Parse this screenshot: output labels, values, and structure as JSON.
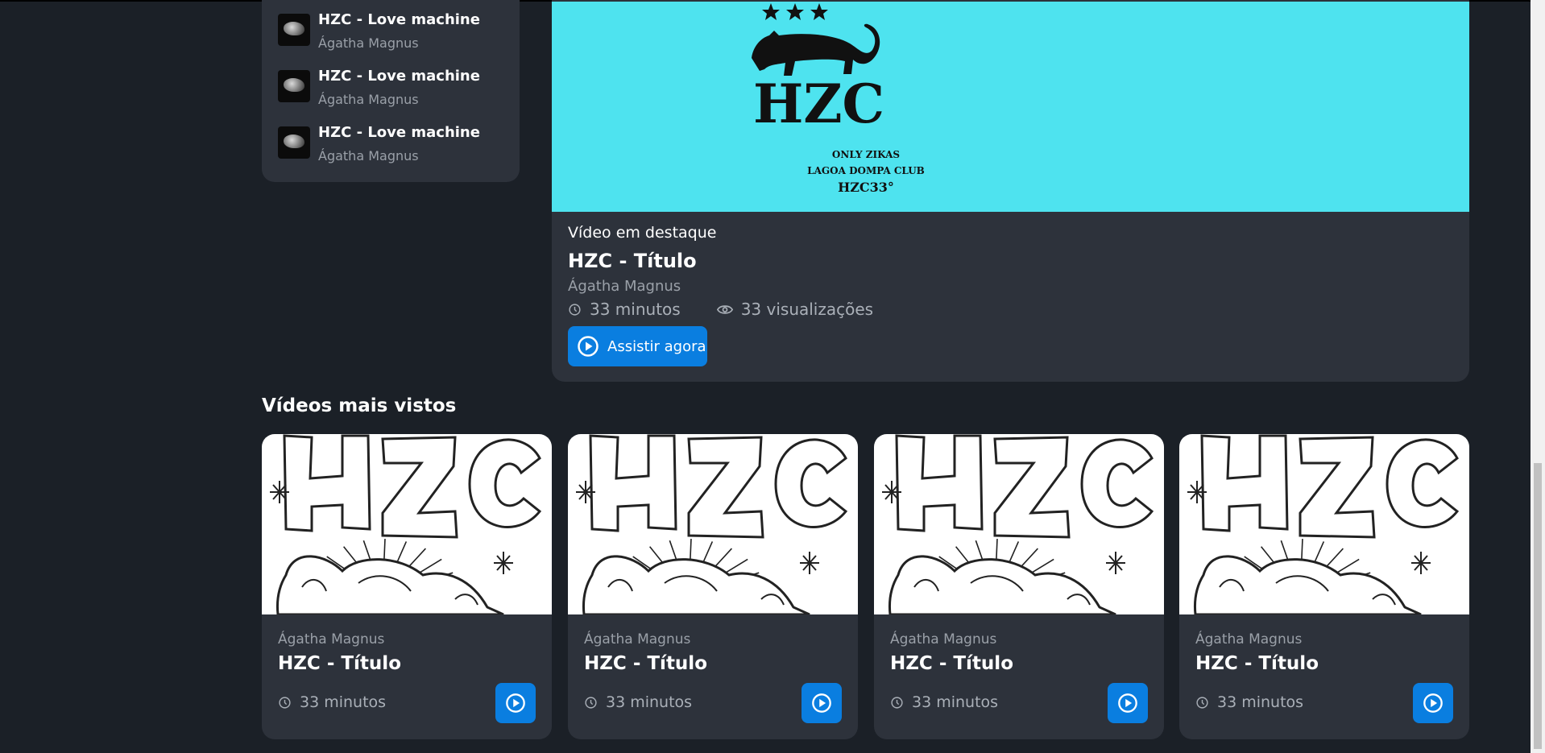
{
  "playlist": {
    "items": [
      {
        "title": "HZC - Love machine",
        "author": "Ágatha Magnus"
      },
      {
        "title": "HZC - Love machine",
        "author": "Ágatha Magnus"
      },
      {
        "title": "HZC - Love machine",
        "author": "Ágatha Magnus"
      }
    ]
  },
  "featured": {
    "label": "Vídeo em destaque",
    "title": "HZC - Título",
    "author": "Ágatha Magnus",
    "duration": "33 minutos",
    "views": "33 visualizações",
    "watch_label": "Assistir agora",
    "hero_logo": {
      "brand": "HZC",
      "line1": "ONLY ZIKAS",
      "line2": "LAGOA DOMPA CLUB",
      "line3": "HZC33°",
      "background": "#4ee3ef"
    }
  },
  "most_viewed": {
    "title": "Vídeos mais vistos",
    "cards": [
      {
        "author": "Ágatha Magnus",
        "title": "HZC - Título",
        "duration": "33 minutos"
      },
      {
        "author": "Ágatha Magnus",
        "title": "HZC - Título",
        "duration": "33 minutos"
      },
      {
        "author": "Ágatha Magnus",
        "title": "HZC - Título",
        "duration": "33 minutos"
      },
      {
        "author": "Ágatha Magnus",
        "title": "HZC - Título",
        "duration": "33 minutos"
      }
    ]
  },
  "colors": {
    "background": "#1b2027",
    "card": "#2d323b",
    "accent": "#0a7ee0",
    "muted": "#9aa0a8"
  },
  "icons": [
    "clock-icon",
    "eye-icon",
    "play-circle-icon"
  ]
}
